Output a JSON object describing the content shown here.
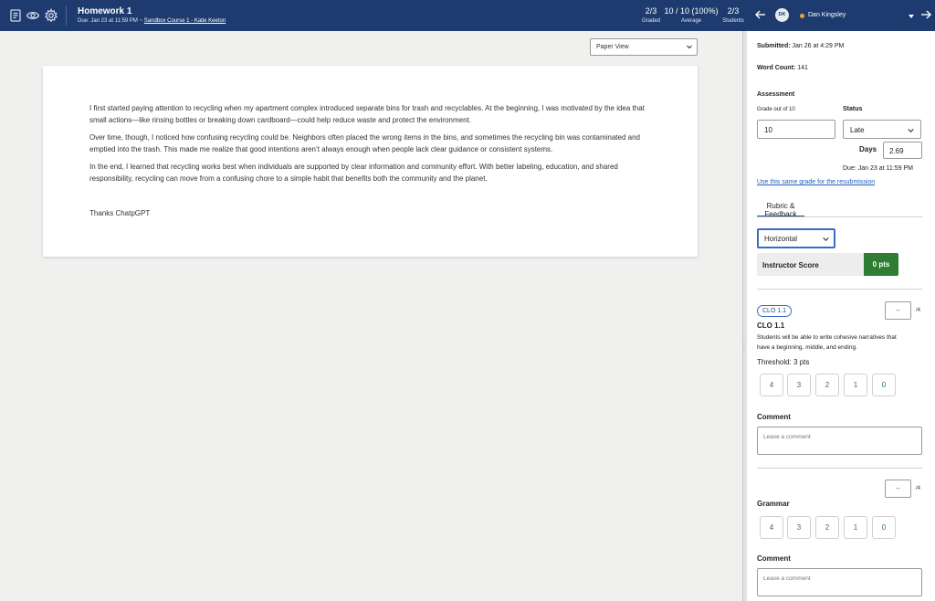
{
  "header": {
    "assignment_title": "Homework 1",
    "due_prefix": "Due: Jan 23 at 11:59 PM  ~",
    "course_link": "Sandbox Course 1 - Katie Keeton",
    "stats": [
      {
        "value": "2/3",
        "label": "Graded"
      },
      {
        "value": "10 / 10 (100%)",
        "label": "Average"
      },
      {
        "value": "2/3",
        "label": "Students"
      }
    ],
    "student": {
      "initials": "DK",
      "name": "Dan Kingsley",
      "status_color": "#f0a232"
    },
    "icons": [
      "document-icon",
      "eye-icon",
      "gear-icon",
      "arrow-left-icon",
      "chevron-down-icon",
      "arrow-right-icon"
    ]
  },
  "submission": {
    "view_select": "Paper View",
    "paragraphs": [
      "I first started paying attention to recycling when my apartment complex introduced separate bins for trash and recyclables. At the beginning, I was motivated by the idea that small actions—like rinsing bottles or breaking down cardboard—could help reduce waste and protect the environment.",
      "Over time, though, I noticed how confusing recycling could be. Neighbors often placed the wrong items in the bins, and sometimes the recycling bin was contaminated and emptied into the trash. This made me realize that good intentions aren’t always enough when people lack clear guidance or consistent systems.",
      "In the end, I learned that recycling works best when individuals are supported by clear information and community effort. With better labeling, education, and shared responsibility, recycling can move from a confusing chore to a simple habit that benefits both the community and the planet.",
      "Thanks ChatpGPT"
    ]
  },
  "panel": {
    "submitted_label": "Submitted:",
    "submitted_value": "Jan 26 at 4:29 PM",
    "word_count_label": "Word Count:",
    "word_count_value": "141",
    "assessment_heading": "Assessment",
    "grade_label": "Grade out of 10",
    "grade_value": "10",
    "status_label": "Status",
    "status_value": "Late",
    "days_label": "Days",
    "days_value": "2.69",
    "due_note": "Due: Jan 23 at 11:59 PM",
    "resubmission_link": "Use this same grade for the resubmission",
    "tab_label": "Rubric & Feedback",
    "layout_select": "Horizontal",
    "instructor_score_label": "Instructor Score",
    "instructor_score_value": "0 pts",
    "criteria": [
      {
        "badge": "CLO 1.1",
        "title": "CLO 1.1",
        "description_lines": [
          "Students will be able to write cohesive narratives that",
          "have a beginning, middle, and ending."
        ],
        "threshold": "Threshold: 3 pts",
        "score_placeholder": "--",
        "max": "/4",
        "levels": [
          "4",
          "3",
          "2",
          "1",
          "0"
        ],
        "comment_label": "Comment",
        "comment_placeholder": "Leave a comment"
      },
      {
        "title": "Grammar",
        "score_placeholder": "--",
        "max": "/4",
        "levels": [
          "4",
          "3",
          "2",
          "1",
          "0"
        ],
        "comment_label": "Comment",
        "comment_placeholder": "Leave a comment"
      }
    ]
  },
  "colors": {
    "header_bg": "#1d3b6e",
    "score_green": "#2e7d32",
    "link_blue": "#1f5fbf"
  }
}
